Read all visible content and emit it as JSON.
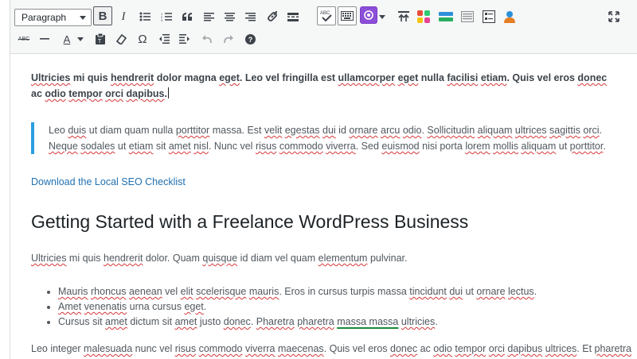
{
  "toolbar": {
    "format_select": {
      "value": "Paragraph"
    },
    "row1": [
      "bold",
      "italic",
      "bullet-list",
      "numbered-list",
      "blockquote",
      "align-left",
      "align-center",
      "align-right",
      "link",
      "read-more",
      "spellcheck",
      "toolbar-toggle",
      "plugin",
      "plugin-dropdown",
      "insert-above",
      "shortcodes",
      "buttons-block",
      "column-block",
      "table-block",
      "user-block",
      "fullscreen"
    ],
    "row2": [
      "strikethrough",
      "horizontal-line",
      "text-color",
      "paste-text",
      "clear-formatting",
      "special-character",
      "outdent",
      "indent",
      "undo",
      "redo",
      "help"
    ],
    "labels": {
      "bold": "B",
      "italic": "I",
      "text_color": "A",
      "omega": "Ω",
      "spellcheck": "ABC",
      "strike": "ABC"
    }
  },
  "content": {
    "p1": [
      {
        "t": "Ultricies",
        "s": 1
      },
      {
        "t": " mi quis "
      },
      {
        "t": "hendrerit",
        "s": 1
      },
      {
        "t": " dolor magna "
      },
      {
        "t": "eget",
        "s": 1
      },
      {
        "t": ". Leo vel fringilla est "
      },
      {
        "t": "ullamcorper",
        "s": 1
      },
      {
        "t": " "
      },
      {
        "t": "eget",
        "s": 1
      },
      {
        "t": " nulla "
      },
      {
        "t": "facilisi",
        "s": 1
      },
      {
        "t": " "
      },
      {
        "t": "etiam",
        "s": 1
      },
      {
        "t": ". Quis vel eros "
      },
      {
        "t": "donec",
        "s": 1
      },
      {
        "t": " ac "
      },
      {
        "t": "odio",
        "s": 1
      },
      {
        "t": " "
      },
      {
        "t": "tempor",
        "s": 1
      },
      {
        "t": " "
      },
      {
        "t": "orci",
        "s": 1
      },
      {
        "t": " "
      },
      {
        "t": "dapibus",
        "s": 1
      },
      {
        "t": "."
      }
    ],
    "blockquote": [
      {
        "t": "Leo "
      },
      {
        "t": "duis",
        "s": 1
      },
      {
        "t": " ut diam quam nulla "
      },
      {
        "t": "porttitor",
        "s": 1
      },
      {
        "t": " massa. Est "
      },
      {
        "t": "velit",
        "s": 1
      },
      {
        "t": " "
      },
      {
        "t": "egestas",
        "s": 1
      },
      {
        "t": " "
      },
      {
        "t": "dui",
        "s": 1
      },
      {
        "t": " id "
      },
      {
        "t": "ornare",
        "s": 1
      },
      {
        "t": " "
      },
      {
        "t": "arcu",
        "s": 1
      },
      {
        "t": " "
      },
      {
        "t": "odio",
        "s": 1
      },
      {
        "t": ". "
      },
      {
        "t": "Sollicitudin",
        "s": 1
      },
      {
        "t": " "
      },
      {
        "t": "aliquam",
        "s": 1
      },
      {
        "t": " "
      },
      {
        "t": "ultrices",
        "s": 1
      },
      {
        "t": " "
      },
      {
        "t": "sagittis",
        "s": 1
      },
      {
        "t": " "
      },
      {
        "t": "orci",
        "s": 1
      },
      {
        "t": ". "
      },
      {
        "t": "Neque",
        "s": 1
      },
      {
        "t": " "
      },
      {
        "t": "sodales",
        "s": 1
      },
      {
        "t": " ut "
      },
      {
        "t": "etiam",
        "s": 1
      },
      {
        "t": " sit "
      },
      {
        "t": "amet",
        "s": 1
      },
      {
        "t": " "
      },
      {
        "t": "nisl",
        "s": 1
      },
      {
        "t": ". Nunc vel "
      },
      {
        "t": "risus",
        "s": 1
      },
      {
        "t": " "
      },
      {
        "t": "commodo",
        "s": 1
      },
      {
        "t": " "
      },
      {
        "t": "viverra",
        "s": 1
      },
      {
        "t": ". Sed "
      },
      {
        "t": "euismod",
        "s": 1
      },
      {
        "t": " nisi porta "
      },
      {
        "t": "lorem",
        "s": 1
      },
      {
        "t": " "
      },
      {
        "t": "mollis",
        "s": 1
      },
      {
        "t": " "
      },
      {
        "t": "aliquam",
        "s": 1
      },
      {
        "t": " ut "
      },
      {
        "t": "porttitor",
        "s": 1
      },
      {
        "t": "."
      }
    ],
    "link_text": "Download the Local SEO Checklist",
    "heading": "Getting Started with a Freelance WordPress Business",
    "p2": [
      {
        "t": "Ultricies",
        "s": 1
      },
      {
        "t": " mi quis "
      },
      {
        "t": "hendrerit",
        "s": 1
      },
      {
        "t": " dolor. Quam "
      },
      {
        "t": "quisque",
        "s": 1
      },
      {
        "t": " id diam vel quam "
      },
      {
        "t": "elementum",
        "s": 1
      },
      {
        "t": " pulvinar."
      }
    ],
    "list": [
      [
        {
          "t": "Mauris",
          "s": 1
        },
        {
          "t": " "
        },
        {
          "t": "rhoncus",
          "s": 1
        },
        {
          "t": " "
        },
        {
          "t": "aenean",
          "s": 1
        },
        {
          "t": " vel "
        },
        {
          "t": "elit",
          "s": 1
        },
        {
          "t": " "
        },
        {
          "t": "scelerisque",
          "s": 1
        },
        {
          "t": " "
        },
        {
          "t": "mauris",
          "s": 1
        },
        {
          "t": ". Eros in cursus turpis massa "
        },
        {
          "t": "tincidunt",
          "s": 1
        },
        {
          "t": " "
        },
        {
          "t": "dui",
          "s": 1
        },
        {
          "t": " ut "
        },
        {
          "t": "ornare",
          "s": 1
        },
        {
          "t": " "
        },
        {
          "t": "lectus",
          "s": 1
        },
        {
          "t": "."
        }
      ],
      [
        {
          "t": "Amet",
          "s": 1
        },
        {
          "t": " "
        },
        {
          "t": "venenatis",
          "s": 1
        },
        {
          "t": " urna cursus "
        },
        {
          "t": "eget",
          "s": 1
        },
        {
          "t": "."
        }
      ],
      [
        {
          "t": "Cursus sit "
        },
        {
          "t": "amet",
          "s": 1
        },
        {
          "t": " dictum sit "
        },
        {
          "t": "amet",
          "s": 1
        },
        {
          "t": " justo "
        },
        {
          "t": "donec",
          "s": 1
        },
        {
          "t": ". "
        },
        {
          "t": "Pharetra",
          "s": 1
        },
        {
          "t": " "
        },
        {
          "t": "pharetra",
          "s": 1
        },
        {
          "t": " "
        },
        {
          "t": "massa massa",
          "s": 2
        },
        {
          "t": " "
        },
        {
          "t": "ultricies",
          "s": 1
        },
        {
          "t": "."
        }
      ]
    ],
    "p3": [
      {
        "t": "Leo integer "
      },
      {
        "t": "malesuada",
        "s": 1
      },
      {
        "t": " nunc vel "
      },
      {
        "t": "risus",
        "s": 1
      },
      {
        "t": " "
      },
      {
        "t": "commodo",
        "s": 1
      },
      {
        "t": " "
      },
      {
        "t": "viverra",
        "s": 1
      },
      {
        "t": " "
      },
      {
        "t": "maecenas",
        "s": 1
      },
      {
        "t": ". Quis vel eros "
      },
      {
        "t": "donec",
        "s": 1
      },
      {
        "t": " ac "
      },
      {
        "t": "odio",
        "s": 1
      },
      {
        "t": " "
      },
      {
        "t": "tempor",
        "s": 1
      },
      {
        "t": " "
      },
      {
        "t": "orci",
        "s": 1
      },
      {
        "t": " "
      },
      {
        "t": "dapibus",
        "s": 1
      },
      {
        "t": " "
      },
      {
        "t": "ultrices",
        "s": 1
      },
      {
        "t": ". Et "
      },
      {
        "t": "pharetra",
        "s": 1
      }
    ]
  },
  "colors": {
    "accent": "#2c9ee0",
    "link": "#2271b1",
    "spell_error": "#d63638",
    "grammar": "#1a8a3a"
  }
}
